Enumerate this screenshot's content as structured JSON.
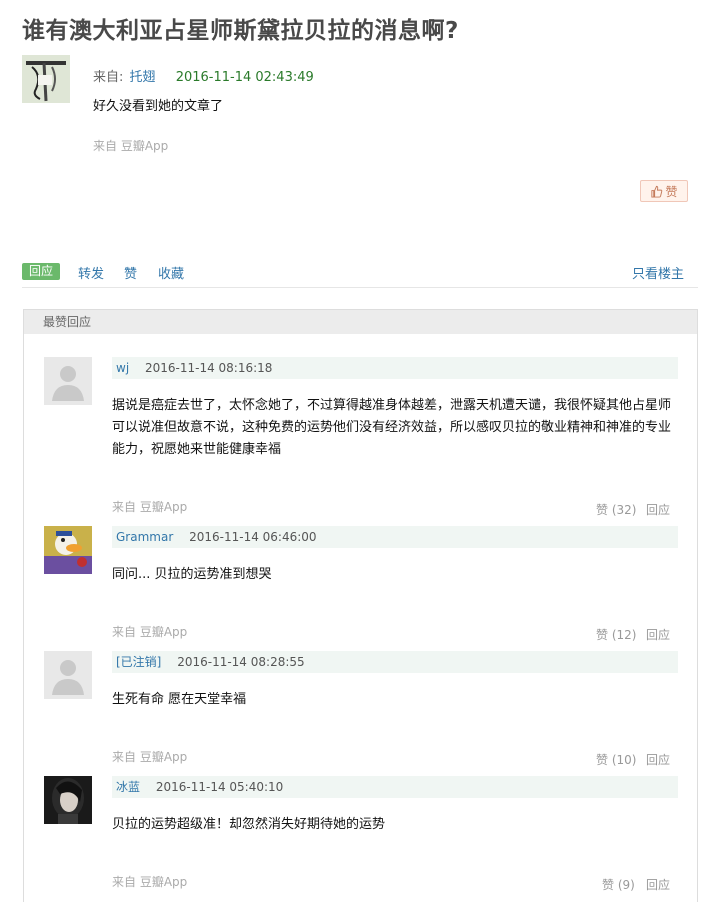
{
  "post": {
    "title": "谁有澳大利亚占星师斯黛拉贝拉的消息啊?",
    "from_label": "来自:",
    "author": "托翅",
    "time": "2016-11-14 02:43:49",
    "body": "好久没看到她的文章了",
    "source": "来自 豆瓣App",
    "like_label": "赞"
  },
  "actions": {
    "reply": "回应",
    "forward": "转发",
    "like": "赞",
    "collect": "收藏",
    "only_op": "只看楼主"
  },
  "best_replies": {
    "heading": "最赞回应",
    "items": [
      {
        "author": "wj",
        "time": "2016-11-14 08:16:18",
        "text": "据说是癌症去世了，太怀念她了，不过算得越准身体越差，泄露天机遭天谴，我很怀疑其他占星师可以说准但故意不说，这种免费的运势他们没有经济效益，所以感叹贝拉的敬业精神和神准的专业能力，祝愿她来世能健康幸福",
        "source": "来自 豆瓣App",
        "likes": "赞 (32)",
        "reply": "回应",
        "avatar": "default-avatar"
      },
      {
        "author": "Grammar",
        "time": "2016-11-14 06:46:00",
        "text": "同问... 贝拉的运势准到想哭",
        "source": "来自 豆瓣App",
        "likes": "赞 (12)",
        "reply": "回应",
        "avatar": "cartoon-avatar"
      },
      {
        "author": "[已注销]",
        "time": "2016-11-14 08:28:55",
        "text": "生死有命 愿在天堂幸福",
        "source": "来自 豆瓣App",
        "likes": "赞 (10)",
        "reply": "回应",
        "avatar": "default-avatar"
      },
      {
        "author": "冰蓝",
        "time": "2016-11-14 05:40:10",
        "text": "贝拉的运势超级准！却忽然消失好期待她的运势",
        "source": "来自 豆瓣App",
        "likes": "赞 (9)",
        "reply": "回应",
        "avatar": "photo-avatar"
      }
    ]
  },
  "colors": {
    "link": "#3377aa",
    "reply_tag": "#6bb96b",
    "time_green": "#2a7a2a"
  }
}
